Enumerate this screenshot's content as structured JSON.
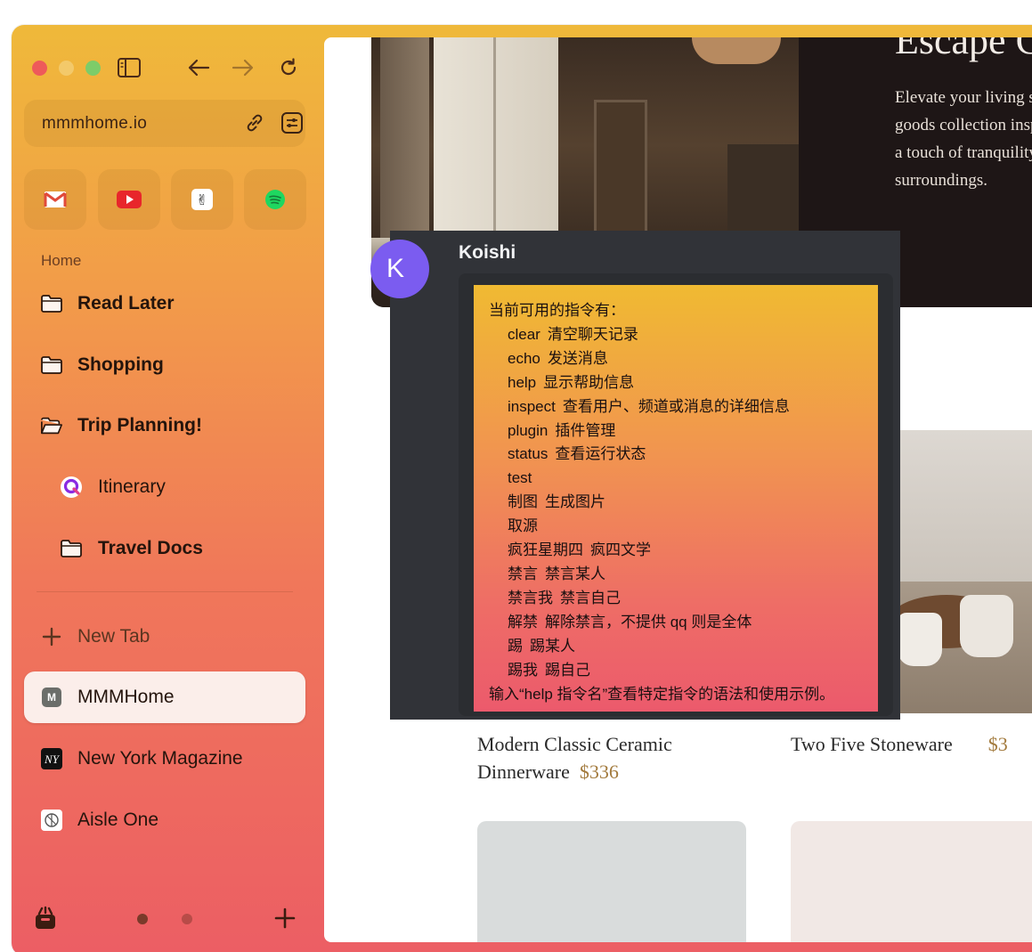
{
  "toolbar": {
    "url": "mmmhome.io"
  },
  "sidebar": {
    "section": "Home",
    "folders": [
      {
        "label": "Read Later"
      },
      {
        "label": "Shopping"
      },
      {
        "label": "Trip Planning!"
      }
    ],
    "trip_children": [
      {
        "label": "Itinerary"
      },
      {
        "label": "Travel Docs"
      }
    ],
    "new_tab": "New Tab",
    "tabs": [
      {
        "label": "MMMHome",
        "favicon_letter": "M"
      },
      {
        "label": "New York Magazine"
      },
      {
        "label": "Aisle One"
      }
    ],
    "favorites": [
      "gmail-icon",
      "youtube-icon",
      "angellist-icon",
      "spotify-icon"
    ]
  },
  "page": {
    "hero_title": "Escape Co",
    "hero_text": [
      "Elevate your living spa",
      "goods collection inspir",
      "a touch of tranquility a",
      "surroundings."
    ],
    "product1_name_line1": "Modern Classic Ceramic",
    "product1_name_line2": "Dinnerware",
    "product1_price": "$336",
    "product2_name": "Two Five Stoneware",
    "product2_price": "$3"
  },
  "chat": {
    "avatar_letter": "K",
    "username": "Koishi",
    "help_title": "当前可用的指令有：",
    "commands": [
      {
        "name": "clear",
        "desc": "清空聊天记录"
      },
      {
        "name": "echo",
        "desc": "发送消息"
      },
      {
        "name": "help",
        "desc": "显示帮助信息"
      },
      {
        "name": "inspect",
        "desc": "查看用户、频道或消息的详细信息"
      },
      {
        "name": "plugin",
        "desc": "插件管理"
      },
      {
        "name": "status",
        "desc": "查看运行状态"
      },
      {
        "name": "test",
        "desc": ""
      },
      {
        "name": "制图",
        "desc": "生成图片"
      },
      {
        "name": "取源",
        "desc": ""
      },
      {
        "name": "疯狂星期四",
        "desc": "疯四文学"
      },
      {
        "name": "禁言",
        "desc": "禁言某人"
      },
      {
        "name": "禁言我",
        "desc": "禁言自己"
      },
      {
        "name": "解禁",
        "desc": "解除禁言，不提供 qq 则是全体"
      },
      {
        "name": "踢",
        "desc": "踢某人"
      },
      {
        "name": "踢我",
        "desc": "踢自己"
      }
    ],
    "help_footer": "输入“help 指令名”查看特定指令的语法和使用示例。"
  }
}
